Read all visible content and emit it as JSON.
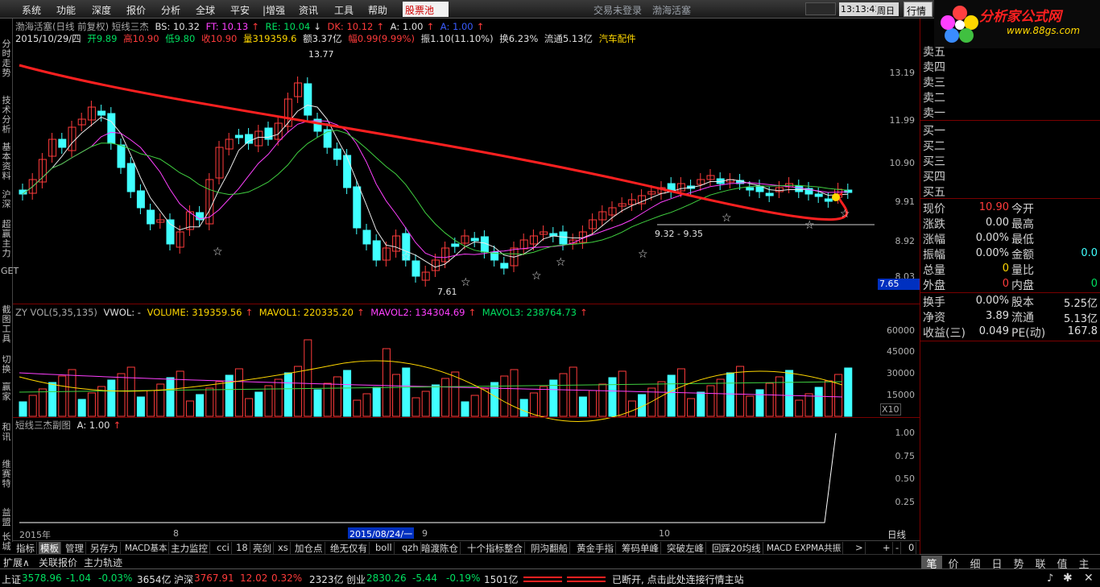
{
  "menu": {
    "items": [
      "系统",
      "功能",
      "深度",
      "报价",
      "分析",
      "全球",
      "平安",
      "|增强",
      "资讯",
      "工具",
      "帮助"
    ],
    "highlight": "股票池",
    "trade_status": "交易未登录",
    "stock_name": "渤海活塞",
    "clock": "13:13:43",
    "weekday": "周日",
    "quote_button": "行情"
  },
  "logo": {
    "text": "分析家公式网",
    "url": "www.88gs.com"
  },
  "left_tabs": [
    "分时走势",
    "技术分析",
    "基本资料",
    "沪深",
    "超赢主力",
    "GET",
    "截图工具",
    "切换",
    "赢家",
    "和讯",
    "维赛特",
    "益盟",
    "长城"
  ],
  "info": {
    "line1": {
      "title": "渤海活塞(日线 前复权) 短线三杰",
      "bs": "BS: 10.32",
      "ft": "FT: 10.13",
      "re": "RE: 10.04",
      "dk": "DK: 10.12",
      "a1": "A: 1.00",
      "a2": "A: 1.00"
    },
    "line2": {
      "date": "2015/10/29/四",
      "open": "开9.89",
      "high": "高10.90",
      "low": "低9.80",
      "close": "收10.90",
      "volume": "量319359.6",
      "amount": "额3.37亿",
      "change": "幅0.99(9.99%)",
      "amplitude": "振1.10(11.10%)",
      "turnover": "换6.23%",
      "float": "流通5.13亿",
      "industry": "汽车配件"
    }
  },
  "price_axis": [
    "13.19",
    "11.99",
    "10.90",
    "9.91",
    "8.92",
    "8.03"
  ],
  "price_marker": "7.65",
  "annotations": {
    "high": "13.77",
    "low": "7.61",
    "range": "9.32 - 9.35"
  },
  "volume_header": {
    "title": "ZY VOL(5,35,135)",
    "vwol": "VWOL: -",
    "volume": "VOLUME: 319359.56",
    "mavol1": "MAVOL1: 220335.20",
    "mavol2": "MAVOL2: 134304.69",
    "mavol3": "MAVOL3: 238764.73"
  },
  "volume_axis": [
    "60000",
    "45000",
    "30000",
    "15000"
  ],
  "volume_unit": "X10",
  "sub_header": {
    "title": "短线三杰副图",
    "a": "A: 1.00"
  },
  "sub_axis": [
    "1.00",
    "0.75",
    "0.50",
    "0.25"
  ],
  "date_axis": {
    "year": "2015年",
    "months": [
      "8",
      "9",
      "10"
    ],
    "cursor": "2015/08/24/一",
    "period": "日线"
  },
  "bottom_tabs": [
    "指标",
    "模板",
    "管理",
    "另存为",
    "MACD基本",
    "主力监控",
    "cci",
    "18",
    "亮剑",
    "xs",
    "加仓点",
    "绝无仅有",
    "boll",
    "qzh",
    "暗渡陈仓",
    "十个指标整合",
    "阴沟翻船",
    "黄金手指",
    "筹码单峰",
    "突破左峰",
    "回踩20均线",
    "MACD EXPMA共振"
  ],
  "bottom_controls": [
    ">",
    "+",
    "-",
    "0"
  ],
  "left_bottom": [
    "扩展∧",
    "关联报价",
    "主力轨迹"
  ],
  "status": {
    "sh_label": "上证",
    "sh_value": "3578.96",
    "sh_change": "-1.04",
    "sh_pct": "-0.03%",
    "sh_amount": "3654亿",
    "sz_label": "沪深",
    "sz_value": "3767.91",
    "sz_change": "12.02",
    "sz_pct": "0.32%",
    "sz_amount": "2323亿",
    "cy_label": "创业",
    "cy_value": "2830.26",
    "cy_change": "-5.44",
    "cy_pct": "-0.19%",
    "cy_amount": "1501亿",
    "conn_msg": "已断开, 点击此处连接行情主站"
  },
  "orderbook": {
    "sell": [
      "卖五",
      "卖四",
      "卖三",
      "卖二",
      "卖一"
    ],
    "buy": [
      "买一",
      "买二",
      "买三",
      "买四",
      "买五"
    ]
  },
  "quote": [
    {
      "l1": "现价",
      "v1": "10.90",
      "l2": "今开",
      "v2": ""
    },
    {
      "l1": "涨跌",
      "v1": "0.00",
      "l2": "最高",
      "v2": ""
    },
    {
      "l1": "涨幅",
      "v1": "0.00%",
      "l2": "最低",
      "v2": ""
    },
    {
      "l1": "振幅",
      "v1": "0.00%",
      "l2": "金额",
      "v2": "0.0"
    },
    {
      "l1": "总量",
      "v1": "0",
      "l2": "量比",
      "v2": ""
    },
    {
      "l1": "外盘",
      "v1": "0",
      "l2": "内盘",
      "v2": "0"
    }
  ],
  "fundamentals": [
    {
      "l1": "换手",
      "v1": "0.00%",
      "l2": "股本",
      "v2": "5.25亿"
    },
    {
      "l1": "净资",
      "v1": "3.89",
      "l2": "流通",
      "v2": "5.13亿"
    },
    {
      "l1": "收益(三)",
      "v1": "0.049",
      "l2": "PE(动)",
      "v2": "167.8"
    }
  ],
  "right_tabs": [
    "笔",
    "价",
    "细",
    "日",
    "势",
    "联",
    "值",
    "主"
  ],
  "colors": {
    "up": "#ff3b3b",
    "down": "#40ffff",
    "ma_red": "#ff2020"
  }
}
